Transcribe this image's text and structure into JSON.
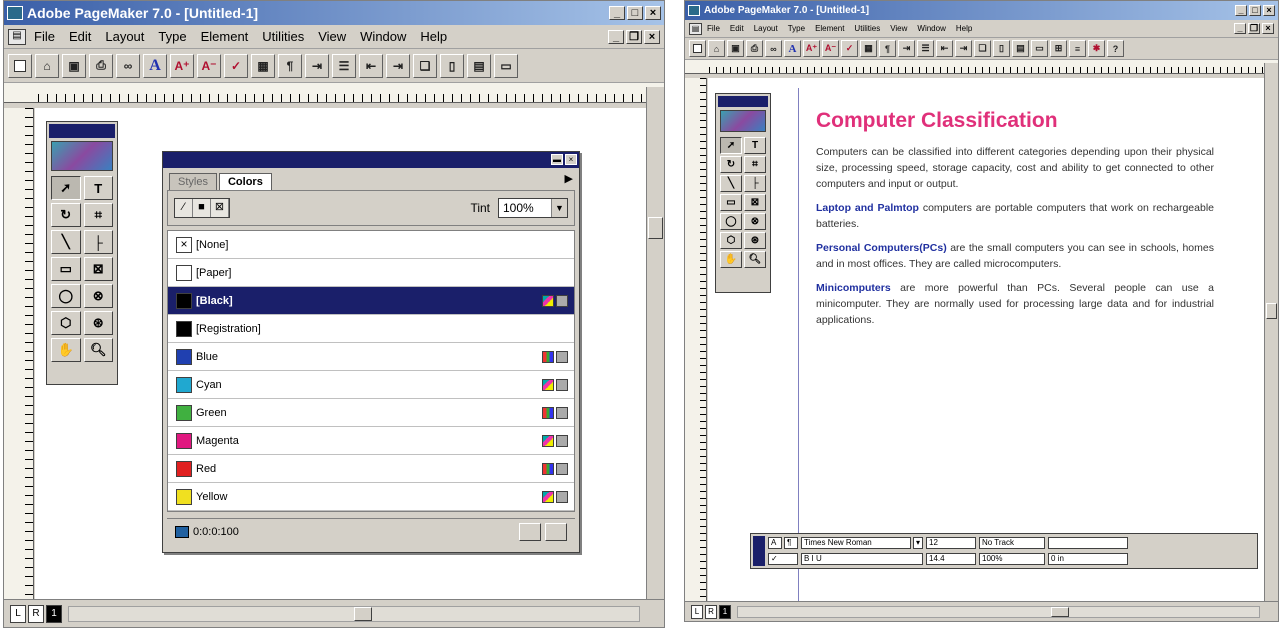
{
  "left_window": {
    "title": "Adobe PageMaker 7.0 - [Untitled-1]",
    "menus": [
      "File",
      "Edit",
      "Layout",
      "Type",
      "Element",
      "Utilities",
      "View",
      "Window",
      "Help"
    ],
    "pages": [
      "L",
      "R",
      "1"
    ],
    "palette": {
      "tabs": [
        "Styles",
        "Colors"
      ],
      "tint_label": "Tint",
      "tint_value": "100%",
      "colors": [
        {
          "name": "[None]",
          "swatch": "#ffffff"
        },
        {
          "name": "[Paper]",
          "swatch": "#ffffff"
        },
        {
          "name": "[Black]",
          "swatch": "#000000"
        },
        {
          "name": "[Registration]",
          "swatch": "#000000"
        },
        {
          "name": "Blue",
          "swatch": "#2040b0"
        },
        {
          "name": "Cyan",
          "swatch": "#20a8d0"
        },
        {
          "name": "Green",
          "swatch": "#40b040"
        },
        {
          "name": "Magenta",
          "swatch": "#e01880"
        },
        {
          "name": "Red",
          "swatch": "#e02020"
        },
        {
          "name": "Yellow",
          "swatch": "#f0e020"
        }
      ],
      "footer_value": "0:0:0:100"
    }
  },
  "right_window": {
    "title": "Adobe PageMaker 7.0 - [Untitled-1]",
    "menus": [
      "File",
      "Edit",
      "Layout",
      "Type",
      "Element",
      "Utilities",
      "View",
      "Window",
      "Help"
    ],
    "pages": [
      "L",
      "R",
      "1"
    ],
    "document": {
      "heading": "Computer Classification",
      "intro": "Computers can be classified into different categories depending upon their physical size, processing speed, storage capacity, cost and ability to get connected to other computers and input or output.",
      "p1_kw": "Laptop and Palmtop",
      "p1": " computers are portable computers that work on rechargeable batteries.",
      "p2_kw": "Personal Computers(PCs)",
      "p2": " are the small computers you can see in schools, homes and in most offices. They are called microcomputers.",
      "p3_kw": "Minicomputers",
      "p3": " are more powerful than PCs. Several people can use a minicomputer. They are normally used for processing large data and for industrial applications."
    },
    "control_palette": {
      "font": "Times New Roman",
      "size": "12",
      "leading": "14.4",
      "track": "No Track",
      "scale": "100%",
      "indent": "0 in"
    }
  },
  "colors": {
    "accent": "#1a1f6a",
    "heading": "#e0307a",
    "keyword": "#2030a0"
  }
}
